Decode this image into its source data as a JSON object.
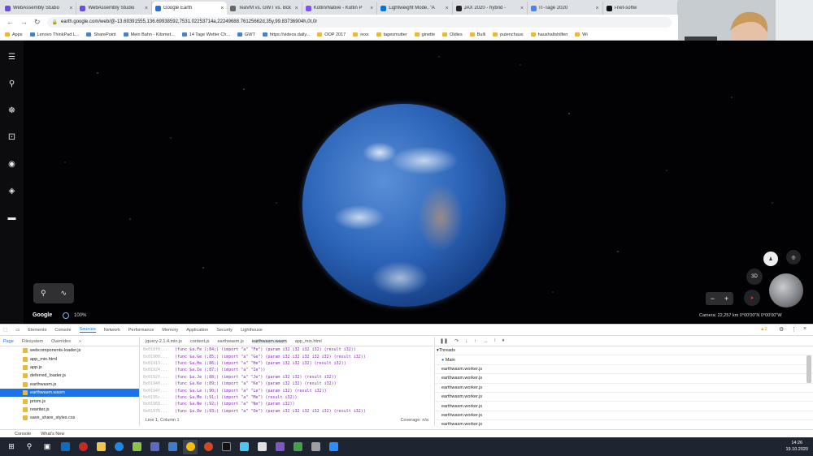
{
  "tabs": [
    {
      "title": "WebAssembly Studio",
      "color": "#6c4fd3"
    },
    {
      "title": "WebAssembly Studio",
      "color": "#6c4fd3"
    },
    {
      "title": "Google Earth",
      "color": "#1a73e8"
    },
    {
      "title": "TeaVM vs. GWT vs. Bck",
      "color": "#666"
    },
    {
      "title": "Kotlin/Native - Kotlin P",
      "color": "#7f52ff"
    },
    {
      "title": "Lightweight Mode, \"A",
      "color": "#0078d4"
    },
    {
      "title": "JAX 2020 - hybrid - ",
      "color": "#222"
    },
    {
      "title": "IT-Tage 2020",
      "color": "#4285f4"
    },
    {
      "title": "i-net-softw",
      "color": "#111"
    }
  ],
  "address": {
    "url": "earth.google.com/web/@-13.69391555,136.69938592,7531.02253714a,22249688.76125662d,35y,99.83736904h,0t,0r"
  },
  "bookmarks": [
    "Apps",
    "Lenovo ThinkPad L...",
    "SharePoint",
    "Mein Bahn - Kilomet...",
    "14 Tage Wetter Ch...",
    "GWT",
    "https://videos.daily...",
    "OOP 2017",
    "rexx",
    "tagesmutter",
    "ginette",
    "Oldies",
    "Bulli",
    "putenchaus",
    "haushaltshilfen",
    "Wi"
  ],
  "earth": {
    "google_label": "Google",
    "zoom": "100%",
    "camera": "Camera: 22,257 km   0°00'00\"N 0°00'00\"W",
    "view3d": "3D"
  },
  "devtools": {
    "tabs": [
      "Elements",
      "Console",
      "Sources",
      "Network",
      "Performance",
      "Memory",
      "Application",
      "Security",
      "Lighthouse"
    ],
    "warning_count": "2",
    "nav_tabs": [
      "Page",
      "Filesystem",
      "Overrides"
    ],
    "files": [
      "webcomponents-loader.js",
      "app_min.html",
      "app.js",
      "deferred_loader.js",
      "earthwasm.js",
      "earthwasm.wasm",
      "prism.js",
      "rewriter.js",
      "save_share_styles.css"
    ],
    "selected_file": "earthwasm.wasm",
    "editor_tabs": [
      "jquery-2.1.4.min.js",
      "content.js",
      "earthwasm.js",
      "earthwasm.wasm",
      "app_min.html"
    ],
    "code": [
      {
        "ln": "0x018f0...",
        "tx": "(func $a.Fe (;84;) (import \"a\" \"Fe\") (param i32 i32 i32 i32) (result i32))"
      },
      {
        "ln": "0x01900...",
        "tx": "(func $a.Ge (;85;) (import \"a\" \"Ge\") (param i32 i32 i32 i32 i32) (result i32))"
      },
      {
        "ln": "0x01913...",
        "tx": "(func $a.He (;86;) (import \"a\" \"He\") (param i32 i32 i32) (result i32))"
      },
      {
        "ln": "0x01924...",
        "tx": "(func $a.Ie (;87;) (import \"a\" \"Ie\"))"
      },
      {
        "ln": "0x0192f...",
        "tx": "(func $a.Je (;88;) (import \"a\" \"Je\") (param i32 i32) (result i32))"
      },
      {
        "ln": "0x01940...",
        "tx": "(func $a.Ke (;89;) (import \"a\" \"Ke\") (param i32 i32) (result i32))"
      },
      {
        "ln": "0x0194f...",
        "tx": "(func $a.Le (;90;) (import \"a\" \"Le\") (param i32) (result i32))"
      },
      {
        "ln": "0x0195c...",
        "tx": "(func $a.Me (;91;) (import \"a\" \"Me\") (result i32))"
      },
      {
        "ln": "0x01969...",
        "tx": "(func $a.Ne (;92;) (import \"a\" \"Ne\") (param i32))"
      },
      {
        "ln": "0x01976...",
        "tx": "(func $a.Oe (;93;) (import \"a\" \"Oe\") (param i32 i32 i32 i32 i32) (result i32))"
      }
    ],
    "status_left": "Line 1, Column 1",
    "status_right": "Coverage: n/a",
    "threads_label": "Threads",
    "main_label": "Main",
    "workers": [
      "earthwasm.worker.js",
      "earthwasm.worker.js",
      "earthwasm.worker.js",
      "earthwasm.worker.js",
      "earthwasm.worker.js",
      "earthwasm.worker.js",
      "earthwasm.worker.js"
    ],
    "drawer": [
      "Console",
      "What's New"
    ]
  },
  "clock": {
    "time": "14:26",
    "date": "19.10.2020"
  }
}
